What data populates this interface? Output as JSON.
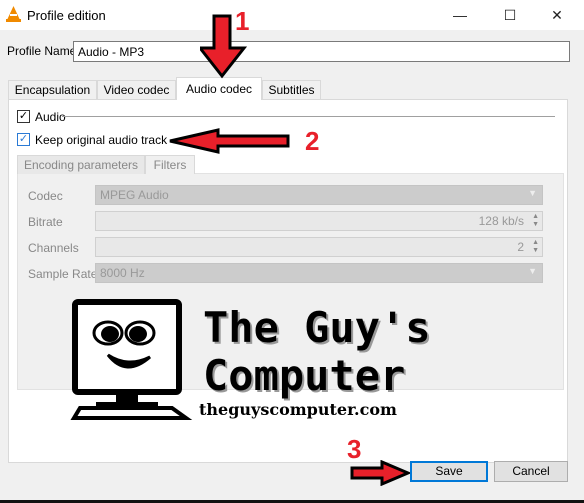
{
  "window": {
    "title": "Profile edition",
    "icon": "vlc-cone-icon",
    "minimize": "—",
    "maximize": "☐",
    "close": "✕"
  },
  "profile": {
    "label": "Profile Name",
    "value": "Audio - MP3"
  },
  "tabs": [
    {
      "label": "Encapsulation"
    },
    {
      "label": "Video codec"
    },
    {
      "label": "Audio codec",
      "active": true
    },
    {
      "label": "Subtitles"
    }
  ],
  "audio": {
    "label": "Audio",
    "checked": true,
    "keep_label": "Keep original audio track",
    "keep_checked": true
  },
  "subtabs": [
    {
      "label": "Encoding parameters"
    },
    {
      "label": "Filters"
    }
  ],
  "fields": {
    "codec": {
      "label": "Codec",
      "value": "MPEG Audio"
    },
    "bitrate": {
      "label": "Bitrate",
      "value": "128 kb/s"
    },
    "channels": {
      "label": "Channels",
      "value": "2"
    },
    "sample_rate": {
      "label": "Sample Rate",
      "value": "8000 Hz"
    }
  },
  "buttons": {
    "save": "Save",
    "cancel": "Cancel"
  },
  "annotations": {
    "step1": "1",
    "step2": "2",
    "step3": "3",
    "color": "#e8202a"
  },
  "watermark": {
    "line1": "The Guy's",
    "line2": "Computer",
    "url": "theguyscomputer.com"
  }
}
